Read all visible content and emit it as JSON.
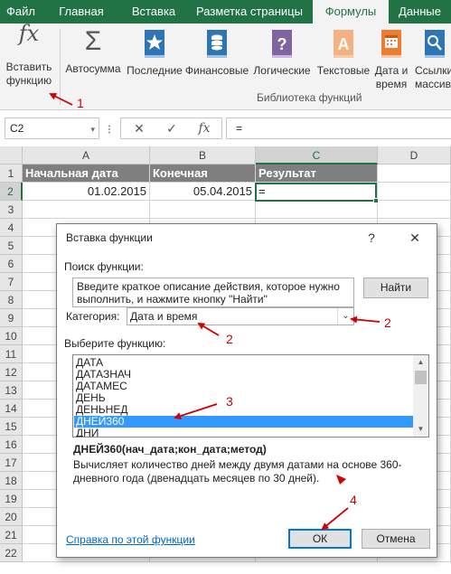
{
  "ribbon": {
    "tabs": [
      "Файл",
      "Главная",
      "Вставка",
      "Разметка страницы",
      "Формулы",
      "Данные"
    ],
    "active_tab": "Формулы",
    "insert_function": {
      "line1": "Вставить",
      "line2": "функцию"
    },
    "autosum": {
      "line1": "Автосумма"
    },
    "recent": {
      "line1": "Последние"
    },
    "financial": {
      "line1": "Финансовые"
    },
    "logical": {
      "line1": "Логические"
    },
    "text": {
      "line1": "Текстовые"
    },
    "datetime": {
      "line1": "Дата и",
      "line2": "время"
    },
    "lookup": {
      "line1": "Ссылки",
      "line2": "массив"
    },
    "group_label": "Библиотека функций",
    "fx_symbol": "fx",
    "sigma_symbol": "Σ"
  },
  "formula_bar": {
    "name_box": "C2",
    "name_box_arrow": "▾",
    "cancel": "✕",
    "enter": "✓",
    "fx": "fx",
    "content": "="
  },
  "grid": {
    "columns": [
      "A",
      "B",
      "C",
      "D"
    ],
    "rows": [
      "1",
      "2",
      "3",
      "4",
      "5",
      "6",
      "7",
      "8",
      "9",
      "10",
      "11",
      "12",
      "13",
      "14",
      "15",
      "16",
      "17",
      "18",
      "19",
      "20",
      "21",
      "22"
    ],
    "r1": {
      "a": "Начальная дата",
      "b": "Конечная",
      "c": "Результат"
    },
    "r2": {
      "a": "01.02.2015",
      "b": "05.04.2015",
      "c": "="
    }
  },
  "dialog": {
    "title": "Вставка функции",
    "help_button": "?",
    "close_button": "✕",
    "search_label": "Поиск функции:",
    "search_text": "Введите краткое описание действия, которое нужно выполнить, и нажмите кнопку \"Найти\"",
    "find_button": "Найти",
    "category_label": "Категория:",
    "category_value": "Дата и время",
    "category_arrow": "⌄",
    "select_label": "Выберите функцию:",
    "functions": [
      "ДАТА",
      "ДАТАЗНАЧ",
      "ДАТАМЕС",
      "ДЕНЬ",
      "ДЕНЬНЕД",
      "ДНЕЙ360",
      "ДНИ"
    ],
    "selected_function": "ДНЕЙ360",
    "scroll_up": "▲",
    "scroll_down": "▼",
    "signature": "ДНЕЙ360(нач_дата;кон_дата;метод)",
    "description": "Вычисляет количество дней между двумя датами на основе 360-дневного года (двенадцать месяцев по 30 дней).",
    "help_link": "Справка по этой функции",
    "ok_button": "ОК",
    "cancel_button": "Отмена"
  },
  "annotations": {
    "n1": "1",
    "n2a": "2",
    "n2b": "2",
    "n3": "3",
    "n4": "4"
  },
  "colors": {
    "excel_green": "#217346",
    "header_gray": "#7f7f7f",
    "selection_blue": "#3399ff",
    "annotation_red": "#d00000"
  }
}
